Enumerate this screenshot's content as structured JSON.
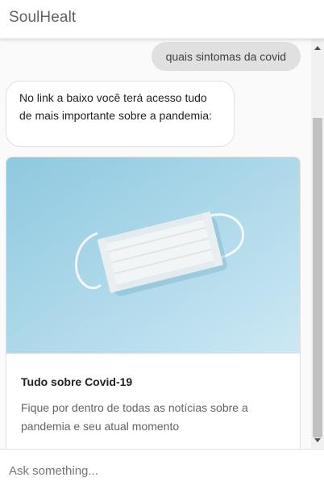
{
  "header": {
    "title": "SoulHealt"
  },
  "messages": {
    "user": "quais sintomas da covid",
    "bot": "No link a baixo você terá acesso tudo de mais importante sobre a pandemia:"
  },
  "card": {
    "image_subject": "surgical-mask",
    "title": "Tudo sobre Covid-19",
    "description": "Fique por dentro de todas as notícias sobre a pandemia e seu atual momento"
  },
  "input": {
    "placeholder": "Ask something...",
    "value": ""
  },
  "colors": {
    "user_bubble": "#e0e0e0",
    "image_background": "#a9d6e8",
    "scrollbar_thumb": "#c1c1c1"
  }
}
